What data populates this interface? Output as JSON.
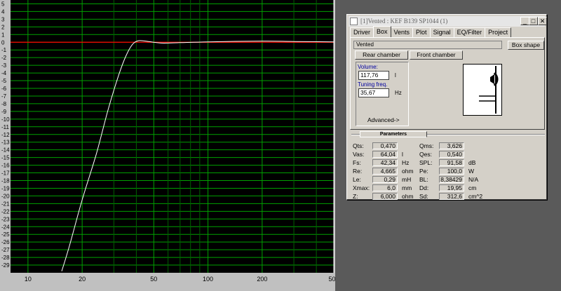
{
  "plot": {
    "y_ticks": [
      5,
      4,
      3,
      2,
      1,
      0,
      -1,
      -2,
      -3,
      -4,
      -5,
      -6,
      -7,
      -8,
      -9,
      -10,
      -11,
      -12,
      -13,
      -14,
      -15,
      -16,
      -17,
      -18,
      -19,
      -20,
      -21,
      -22,
      -23,
      -24,
      -25,
      -26,
      -27,
      -28,
      -29
    ],
    "x_tick_labels": [
      "10",
      "20",
      "50",
      "100",
      "200",
      "500"
    ],
    "x_major": [
      10,
      20,
      50,
      100,
      200,
      500
    ],
    "x_minor": [
      30,
      40,
      60,
      70,
      80,
      90,
      300,
      400
    ],
    "x_range": [
      10,
      500
    ],
    "y_range": [
      -30,
      5.5
    ],
    "colors": {
      "background": "#000000",
      "grid_major": "#00a000",
      "grid_minor": "#006000",
      "zero_line": "#ff0000",
      "curve": "#ffffff"
    },
    "response_curve": {
      "fb_hz": 35.67,
      "points": [
        [
          15.4,
          -29.8
        ],
        [
          17,
          -26.5
        ],
        [
          20,
          -20.5
        ],
        [
          24,
          -14.5
        ],
        [
          28,
          -8.6
        ],
        [
          32,
          -4.2
        ],
        [
          35,
          -1.8
        ],
        [
          38,
          -0.3
        ],
        [
          41,
          0.2
        ],
        [
          45,
          0.15
        ],
        [
          55,
          -0.1
        ],
        [
          70,
          -0.05
        ],
        [
          100,
          0.05
        ],
        [
          200,
          0.15
        ],
        [
          300,
          0.1
        ],
        [
          500,
          0.05
        ]
      ]
    }
  },
  "dialog": {
    "title_prefix": "[1]",
    "title_main": "Vented : KEF B139 SP1044 (1)",
    "window_buttons": {
      "minimize": "_",
      "maximize": "□",
      "close": "✕"
    },
    "tabs": [
      "Driver",
      "Box",
      "Vents",
      "Plot",
      "Signal",
      "EQ/Filter",
      "Project"
    ],
    "active_tab": "Box",
    "box": {
      "type": "Vented",
      "box_shape_label": "Box shape",
      "rear_chamber_label": "Rear chamber",
      "front_chamber_label": "Front chamber",
      "volume_label": "Volume:",
      "volume_value": "117,76",
      "volume_unit": "l",
      "tuning_label": "Tuning freq.",
      "tuning_value": "35,67",
      "tuning_unit": "Hz",
      "advanced_label": "Advanced->"
    },
    "parameters_caption": "Parameters",
    "params_left": [
      {
        "label": "Qts:",
        "value": "0,470",
        "unit": ""
      },
      {
        "label": "Vas:",
        "value": "64,04",
        "unit": "l"
      },
      {
        "label": "Fs:",
        "value": "42,34",
        "unit": "Hz"
      },
      {
        "label": "Re:",
        "value": "4,665",
        "unit": "ohm"
      },
      {
        "label": "Le:",
        "value": "0,29",
        "unit": "mH"
      },
      {
        "label": "Xmax:",
        "value": "6,0",
        "unit": "mm"
      },
      {
        "label": "Z:",
        "value": "6,000",
        "unit": "ohm"
      }
    ],
    "params_right": [
      {
        "label": "Qms:",
        "value": "3,626",
        "unit": ""
      },
      {
        "label": "Qes:",
        "value": "0,540",
        "unit": ""
      },
      {
        "label": "SPL:",
        "value": "91,58",
        "unit": "dB"
      },
      {
        "label": "Pe:",
        "value": "100,0",
        "unit": "W"
      },
      {
        "label": "BL:",
        "value": "8,38429",
        "unit": "N/A"
      },
      {
        "label": "Dd:",
        "value": "19,95",
        "unit": "cm"
      },
      {
        "label": "Sd:",
        "value": "312,6",
        "unit": "cm^2"
      }
    ]
  }
}
